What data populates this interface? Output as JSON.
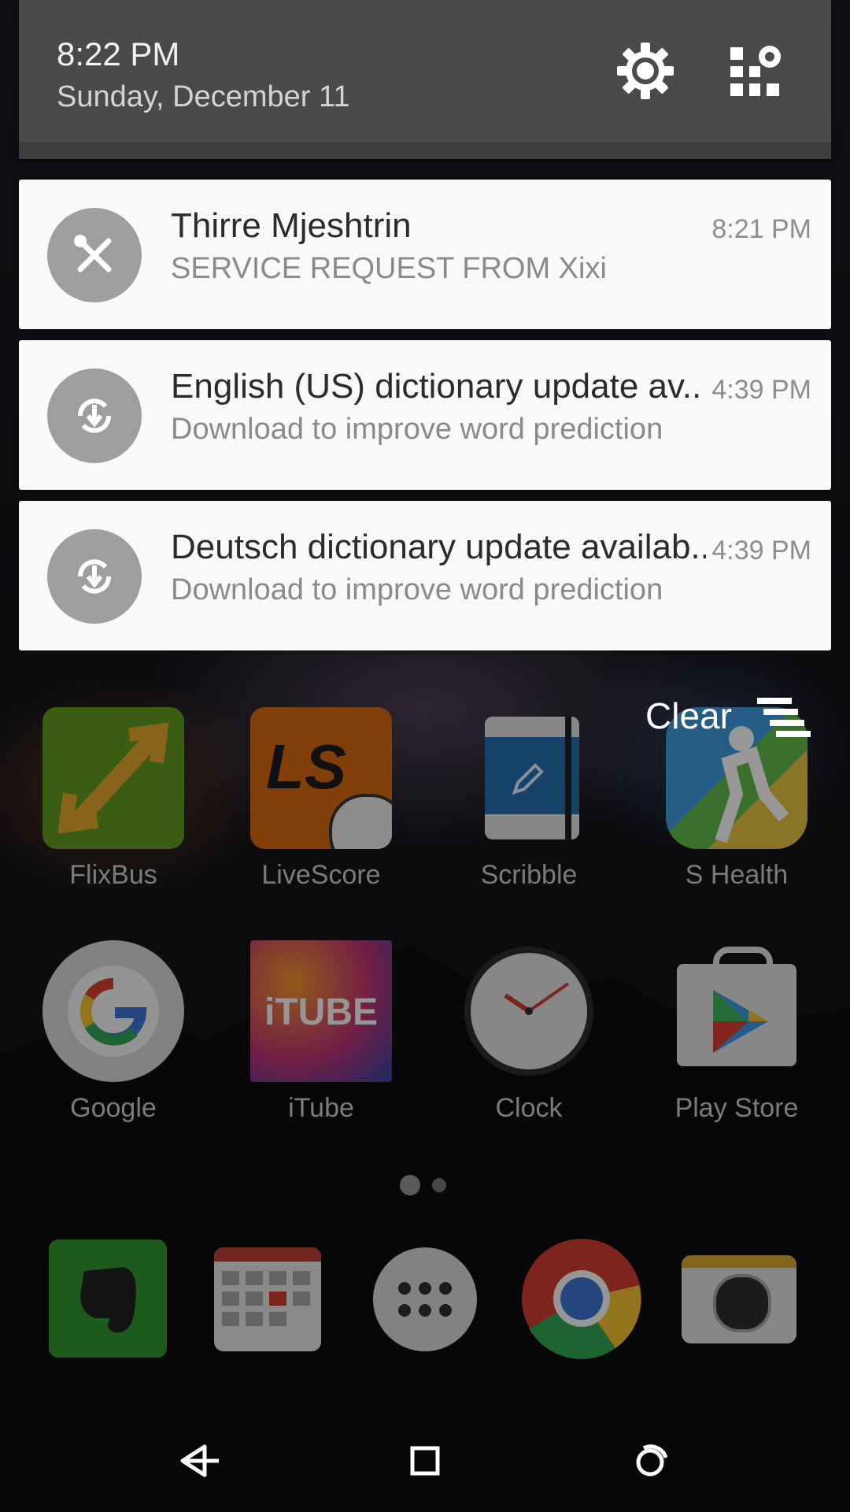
{
  "shade": {
    "time": "8:22 PM",
    "date": "Sunday, December 11"
  },
  "notifications": [
    {
      "title": "Thirre Mjeshtrin",
      "text": "SERVICE REQUEST FROM Xixi",
      "time": "8:21 PM",
      "icon": "wrench-screwdriver-icon"
    },
    {
      "title": "English (US) dictionary update av..",
      "text": "Download to improve word prediction",
      "time": "4:39 PM",
      "icon": "sync-download-icon"
    },
    {
      "title": "Deutsch dictionary update availab..",
      "text": "Download to improve word prediction",
      "time": "4:39 PM",
      "icon": "sync-download-icon"
    }
  ],
  "clear": {
    "label": "Clear"
  },
  "apps": [
    {
      "label": "FlixBus"
    },
    {
      "label": "LiveScore"
    },
    {
      "label": "Scribble"
    },
    {
      "label": "S Health"
    },
    {
      "label": "Google"
    },
    {
      "label": "iTube"
    },
    {
      "label": "Clock"
    },
    {
      "label": "Play Store"
    }
  ],
  "icon_texts": {
    "livescore": "LS",
    "itube": "iTUBE"
  },
  "dock": [
    "evernote-icon",
    "calendar-icon",
    "app-drawer-icon",
    "chrome-icon",
    "camera-icon"
  ],
  "navbar": [
    "back-icon",
    "home-icon",
    "recents-icon"
  ]
}
